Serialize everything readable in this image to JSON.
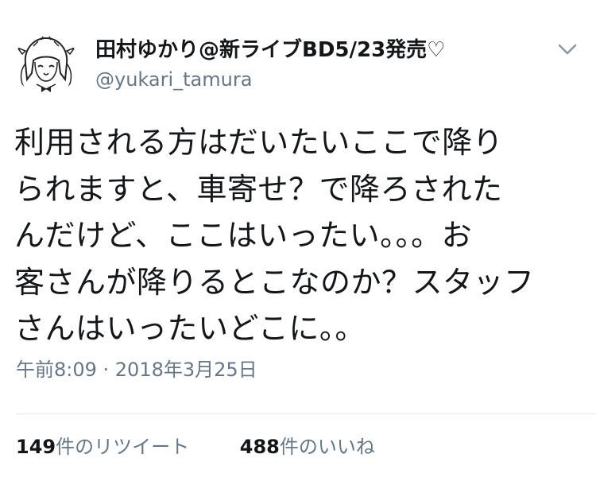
{
  "user": {
    "display_name": "田村ゆかり@新ライブBD5/23発売♡",
    "handle": "@yukari_tamura"
  },
  "tweet": {
    "text": "利用される方はだいたいここで降り\nられますと、車寄せ？で降ろされた\nんだけど、ここはいったい。。。お\n客さんが降りるとこなのか？スタッフ\nさんはいったいどこに。。",
    "timestamp": "午前8:09 · 2018年3月25日"
  },
  "stats": {
    "retweets": "149",
    "retweets_label": "件のリツイート",
    "likes": "488",
    "likes_label": "件のいいね"
  },
  "icons": {
    "menu": "chevron-down-icon",
    "avatar": "avatar-illustration"
  },
  "colors": {
    "text": "#14171a",
    "secondary": "#657786",
    "divider": "#e1e8ed"
  }
}
